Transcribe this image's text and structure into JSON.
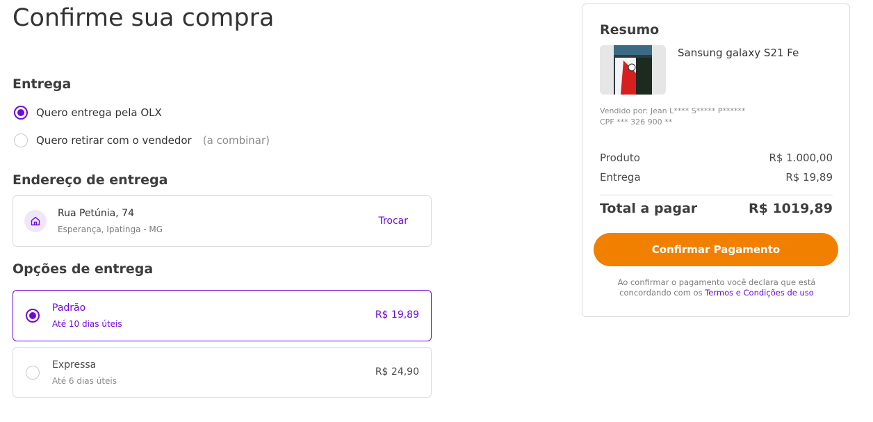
{
  "page": {
    "title": "Confirme sua compra"
  },
  "delivery": {
    "section_title": "Entrega",
    "options": [
      {
        "label": "Quero entrega pela OLX",
        "note": "",
        "selected": true
      },
      {
        "label": "Quero retirar com o vendedor",
        "note": "(a combinar)",
        "selected": false
      }
    ]
  },
  "address": {
    "section_title": "Endereço de entrega",
    "icon": "home-icon",
    "street": "Rua Petúnia, 74",
    "city": "Esperança, Ipatinga - MG",
    "change_label": "Trocar"
  },
  "shipping": {
    "section_title": "Opções de entrega",
    "options": [
      {
        "name": "Padrão",
        "eta": "Até 10 dias úteis",
        "price": "R$ 19,89",
        "selected": true
      },
      {
        "name": "Expressa",
        "eta": "Até 6 dias úteis",
        "price": "R$ 24,90",
        "selected": false
      }
    ]
  },
  "summary": {
    "title": "Resumo",
    "product_name": "Sansung galaxy S21 Fe",
    "seller_line": "Vendido por: Jean L**** S***** P******",
    "cpf_line": "CPF *** 326 900 **",
    "rows": [
      {
        "label": "Produto",
        "value": "R$ 1.000,00"
      },
      {
        "label": "Entrega",
        "value": "R$ 19,89"
      }
    ],
    "total_label": "Total a pagar",
    "total_value": "R$ 1019,89",
    "confirm_label": "Confirmar Pagamento",
    "terms_prefix": "Ao confirmar o pagamento você declara que está concordando com os",
    "terms_link": "Termos e Condições de uso"
  },
  "colors": {
    "accent": "#6e0ad6",
    "cta": "#f28000",
    "border": "#dcdcdc"
  }
}
